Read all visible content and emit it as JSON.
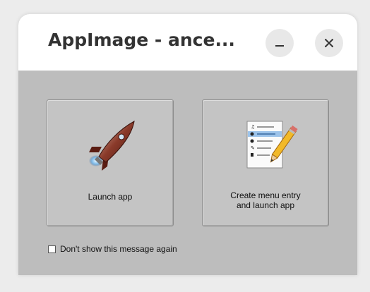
{
  "window": {
    "title": "AppImage - ance...",
    "minimize_icon": "minimize-icon",
    "close_icon": "close-icon"
  },
  "actions": [
    {
      "label": "Launch app",
      "icon": "rocket-icon"
    },
    {
      "label_line1": "Create menu entry",
      "label_line2": "and launch app",
      "icon": "menu-entry-pencil-icon"
    }
  ],
  "dont_show": {
    "label": "Don't show this message again",
    "checked": false
  }
}
